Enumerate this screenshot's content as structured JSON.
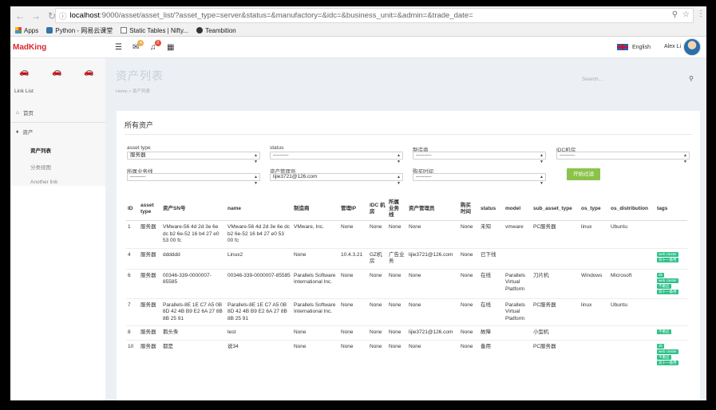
{
  "browser": {
    "url_host": "localhost",
    "url_rest": ":9000/asset/asset_list/?asset_type=server&status=&manufactory=&idc=&business_unit=&admin=&trade_date=",
    "bookmarks": [
      "Apps",
      "Python - 网易云课堂",
      "Static Tables | Nifty...",
      "Teambition"
    ]
  },
  "header": {
    "brand": "MadKing",
    "mail_badge": "4",
    "bell_badge": "3",
    "language": "English",
    "user_name": "Alex Li"
  },
  "sidebar": {
    "title": "Link List",
    "items": [
      {
        "label": "首页"
      },
      {
        "label": "资产"
      }
    ],
    "sub_items": [
      {
        "label": "资产列表"
      },
      {
        "label": "分类视图"
      },
      {
        "label": "Another link"
      }
    ]
  },
  "content": {
    "page_title": "资产列表",
    "breadcrumb": "Home  >  资产列表",
    "search_placeholder": "Search...",
    "panel_title": "所有资产"
  },
  "filters": {
    "asset_type_label": "asset type",
    "asset_type_value": "服务器",
    "status_label": "status",
    "status_value": "---------",
    "manufactory_label": "制造商",
    "manufactory_value": "---------",
    "idc_label": "IDC机房",
    "idc_value": "---------",
    "business_label": "所属业务线",
    "business_value": "---------",
    "admin_label": "资产管理员",
    "admin_value": "lijie3721@126.com",
    "trade_label": "购买时间",
    "trade_value": "---------",
    "filter_button": "开始过滤"
  },
  "table": {
    "headers": [
      "ID",
      "asset type",
      "资产SN号",
      "name",
      "制造商",
      "管理IP",
      "IDC 机房",
      "所属 业务 线",
      "资产管理员",
      "购买 时间",
      "status",
      "model",
      "sub_asset_type",
      "os_type",
      "os_distribution",
      "tags"
    ],
    "rows": [
      {
        "id": "1",
        "type": "服务器",
        "sn": "VMware-56 4d 2d 3e 6e dc b2 6e-52 16 b4 27 e0 53 00 fc",
        "name": "VMware-56 4d 2d 3e 6e dc b2 6e-52 16 b4 27 e0 53 00 fc",
        "manufactory": "VMware, Inc.",
        "ip": "None",
        "idc": "None",
        "business": "None",
        "admin": "None",
        "trade": "None",
        "status": "未知",
        "model": "vmware",
        "sub": "PC服务器",
        "os": "linux",
        "dist": "Ubuntu",
        "tags": []
      },
      {
        "id": "4",
        "type": "服务器",
        "sn": "dddddd",
        "name": "Linux2",
        "manufactory": "None",
        "ip": "10.4.3.21",
        "idc": "GZ机房",
        "business": "广告业务",
        "admin": "lijie3721@126.com",
        "trade": "None",
        "status": "已下线",
        "model": "",
        "sub": "",
        "os": "",
        "dist": "",
        "tags": [
          "web cluster",
          "双十一备用"
        ]
      },
      {
        "id": "6",
        "type": "服务器",
        "sn": "00346-339-0000007-85585",
        "name": "00346-339-0000007-85585",
        "manufactory": "Parallels Software International Inc.",
        "ip": "None",
        "idc": "None",
        "business": "None",
        "admin": "None",
        "trade": "None",
        "status": "在线",
        "model": "Parallels Virtual Platform",
        "sub": "刀片机",
        "os": "Windows",
        "dist": "Microsoft",
        "tags": [
          "db",
          "web cluster",
          "不重启",
          "双十一备用"
        ]
      },
      {
        "id": "7",
        "type": "服务器",
        "sn": "Parallels-8E 1E C7 A5 0B 8D 42 4B B9 E2 6A 27 8B 8B 25 91",
        "name": "Parallels-8E 1E C7 A5 0B 8D 42 4B B9 E2 6A 27 8B 8B 25 91",
        "manufactory": "Parallels Software International Inc.",
        "ip": "None",
        "idc": "None",
        "business": "None",
        "admin": "None",
        "trade": "None",
        "status": "在线",
        "model": "Parallels Virtual Platform",
        "sub": "PC服务器",
        "os": "linux",
        "dist": "Ubuntu",
        "tags": []
      },
      {
        "id": "8",
        "type": "服务器",
        "sn": "鹅头条",
        "name": "test",
        "manufactory": "None",
        "ip": "None",
        "idc": "None",
        "business": "None",
        "admin": "lijie3721@126.com",
        "trade": "None",
        "status": "故障",
        "model": "",
        "sub": "小型机",
        "os": "",
        "dist": "",
        "tags": [
          "不重启"
        ]
      },
      {
        "id": "10",
        "type": "服务器",
        "sn": "都是",
        "name": "说34",
        "manufactory": "None",
        "ip": "None",
        "idc": "None",
        "business": "None",
        "admin": "None",
        "trade": "None",
        "status": "备用",
        "model": "",
        "sub": "PC服务器",
        "os": "",
        "dist": "",
        "tags": [
          "db",
          "web cluster",
          "不重启",
          "双十一备用"
        ]
      }
    ]
  }
}
